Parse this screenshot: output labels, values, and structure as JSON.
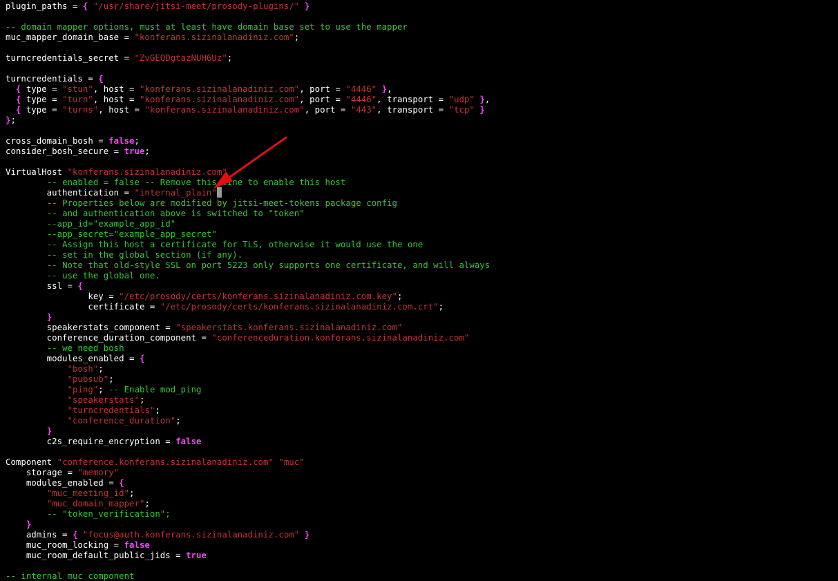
{
  "editor": {
    "colors": {
      "background": "#000000",
      "plain": "#ffffff",
      "string": "#c83232",
      "comment": "#32c832",
      "keyword": "#ff40ff",
      "cursor": "#9a9a9a",
      "annotation_arrow": "#e01010"
    },
    "lines": [
      [
        [
          "plain",
          "plugin_paths = "
        ],
        [
          "brace",
          "{"
        ],
        [
          "plain",
          " "
        ],
        [
          "str",
          "\"/usr/share/jitsi-meet/prosody-plugins/\""
        ],
        [
          "plain",
          " "
        ],
        [
          "brace",
          "}"
        ]
      ],
      [],
      [
        [
          "cmt",
          "-- domain mapper options, must at least have domain base set to use the mapper"
        ]
      ],
      [
        [
          "plain",
          "muc_mapper_domain_base = "
        ],
        [
          "str",
          "\"konferans.sizinalanadiniz.com\""
        ],
        [
          "plain",
          ";"
        ]
      ],
      [],
      [
        [
          "plain",
          "turncredentials_secret = "
        ],
        [
          "str",
          "\"ZvGEQDgtazNUH6Uz\""
        ],
        [
          "plain",
          ";"
        ]
      ],
      [],
      [
        [
          "plain",
          "turncredentials = "
        ],
        [
          "brace",
          "{"
        ]
      ],
      [
        [
          "plain",
          "  "
        ],
        [
          "brace",
          "{"
        ],
        [
          "plain",
          " type = "
        ],
        [
          "str",
          "\"stun\""
        ],
        [
          "plain",
          ", host = "
        ],
        [
          "str",
          "\"konferans.sizinalanadiniz.com\""
        ],
        [
          "plain",
          ", port = "
        ],
        [
          "str",
          "\"4446\""
        ],
        [
          "plain",
          " "
        ],
        [
          "brace",
          "}"
        ],
        [
          "plain",
          ","
        ]
      ],
      [
        [
          "plain",
          "  "
        ],
        [
          "brace",
          "{"
        ],
        [
          "plain",
          " type = "
        ],
        [
          "str",
          "\"turn\""
        ],
        [
          "plain",
          ", host = "
        ],
        [
          "str",
          "\"konferans.sizinalanadiniz.com\""
        ],
        [
          "plain",
          ", port = "
        ],
        [
          "str",
          "\"4446\""
        ],
        [
          "plain",
          ", transport = "
        ],
        [
          "str",
          "\"udp\""
        ],
        [
          "plain",
          " "
        ],
        [
          "brace",
          "}"
        ],
        [
          "plain",
          ","
        ]
      ],
      [
        [
          "plain",
          "  "
        ],
        [
          "brace",
          "{"
        ],
        [
          "plain",
          " type = "
        ],
        [
          "str",
          "\"turns\""
        ],
        [
          "plain",
          ", host = "
        ],
        [
          "str",
          "\"konferans.sizinalanadiniz.com\""
        ],
        [
          "plain",
          ", port = "
        ],
        [
          "str",
          "\"443\""
        ],
        [
          "plain",
          ", transport = "
        ],
        [
          "str",
          "\"tcp\""
        ],
        [
          "plain",
          " "
        ],
        [
          "brace",
          "}"
        ]
      ],
      [
        [
          "brace",
          "}"
        ],
        [
          "plain",
          ";"
        ]
      ],
      [],
      [
        [
          "plain",
          "cross_domain_bosh = "
        ],
        [
          "kw",
          "false"
        ],
        [
          "plain",
          ";"
        ]
      ],
      [
        [
          "plain",
          "consider_bosh_secure = "
        ],
        [
          "kw",
          "true"
        ],
        [
          "plain",
          ";"
        ]
      ],
      [],
      [
        [
          "plain",
          "VirtualHost "
        ],
        [
          "str",
          "\"konferans.sizinalanadiniz.com\""
        ]
      ],
      [
        [
          "plain",
          "        "
        ],
        [
          "cmt",
          "-- enabled = false -- Remove this line to enable this host"
        ]
      ],
      [
        [
          "plain",
          "        authentication = "
        ],
        [
          "str",
          "\"internal_plain\""
        ],
        [
          "cursor",
          " "
        ]
      ],
      [
        [
          "plain",
          "        "
        ],
        [
          "cmt",
          "-- Properties below are modified by jitsi-meet-tokens package config"
        ]
      ],
      [
        [
          "plain",
          "        "
        ],
        [
          "cmt",
          "-- and authentication above is switched to \"token\""
        ]
      ],
      [
        [
          "plain",
          "        "
        ],
        [
          "cmt",
          "--app_id=\"example_app_id\""
        ]
      ],
      [
        [
          "plain",
          "        "
        ],
        [
          "cmt",
          "--app_secret=\"example_app_secret\""
        ]
      ],
      [
        [
          "plain",
          "        "
        ],
        [
          "cmt",
          "-- Assign this host a certificate for TLS, otherwise it would use the one"
        ]
      ],
      [
        [
          "plain",
          "        "
        ],
        [
          "cmt",
          "-- set in the global section (if any)."
        ]
      ],
      [
        [
          "plain",
          "        "
        ],
        [
          "cmt",
          "-- Note that old-style SSL on port 5223 only supports one certificate, and will always"
        ]
      ],
      [
        [
          "plain",
          "        "
        ],
        [
          "cmt",
          "-- use the global one."
        ]
      ],
      [
        [
          "plain",
          "        ssl = "
        ],
        [
          "brace",
          "{"
        ]
      ],
      [
        [
          "plain",
          "                key = "
        ],
        [
          "str",
          "\"/etc/prosody/certs/konferans.sizinalanadiniz.com.key\""
        ],
        [
          "plain",
          ";"
        ]
      ],
      [
        [
          "plain",
          "                certificate = "
        ],
        [
          "str",
          "\"/etc/prosody/certs/konferans.sizinalanadiniz.com.crt\""
        ],
        [
          "plain",
          ";"
        ]
      ],
      [
        [
          "plain",
          "        "
        ],
        [
          "brace",
          "}"
        ]
      ],
      [
        [
          "plain",
          "        speakerstats_component = "
        ],
        [
          "str",
          "\"speakerstats.konferans.sizinalanadiniz.com\""
        ]
      ],
      [
        [
          "plain",
          "        conference_duration_component = "
        ],
        [
          "str",
          "\"conferenceduration.konferans.sizinalanadiniz.com\""
        ]
      ],
      [
        [
          "plain",
          "        "
        ],
        [
          "cmt",
          "-- we need bosh"
        ]
      ],
      [
        [
          "plain",
          "        modules_enabled = "
        ],
        [
          "brace",
          "{"
        ]
      ],
      [
        [
          "plain",
          "            "
        ],
        [
          "str",
          "\"bosh\""
        ],
        [
          "plain",
          ";"
        ]
      ],
      [
        [
          "plain",
          "            "
        ],
        [
          "str",
          "\"pubsub\""
        ],
        [
          "plain",
          ";"
        ]
      ],
      [
        [
          "plain",
          "            "
        ],
        [
          "str",
          "\"ping\""
        ],
        [
          "plain",
          "; "
        ],
        [
          "cmt",
          "-- Enable mod_ping"
        ]
      ],
      [
        [
          "plain",
          "            "
        ],
        [
          "str",
          "\"speakerstats\""
        ],
        [
          "plain",
          ";"
        ]
      ],
      [
        [
          "plain",
          "            "
        ],
        [
          "str",
          "\"turncredentials\""
        ],
        [
          "plain",
          ";"
        ]
      ],
      [
        [
          "plain",
          "            "
        ],
        [
          "str",
          "\"conference_duration\""
        ],
        [
          "plain",
          ";"
        ]
      ],
      [
        [
          "plain",
          "        "
        ],
        [
          "brace",
          "}"
        ]
      ],
      [
        [
          "plain",
          "        c2s_require_encryption = "
        ],
        [
          "kw",
          "false"
        ]
      ],
      [],
      [
        [
          "plain",
          "Component "
        ],
        [
          "str",
          "\"conference.konferans.sizinalanadiniz.com\""
        ],
        [
          "plain",
          " "
        ],
        [
          "str",
          "\"muc\""
        ]
      ],
      [
        [
          "plain",
          "    storage = "
        ],
        [
          "str",
          "\"memory\""
        ]
      ],
      [
        [
          "plain",
          "    modules_enabled = "
        ],
        [
          "brace",
          "{"
        ]
      ],
      [
        [
          "plain",
          "        "
        ],
        [
          "str",
          "\"muc_meeting_id\""
        ],
        [
          "plain",
          ";"
        ]
      ],
      [
        [
          "plain",
          "        "
        ],
        [
          "str",
          "\"muc_domain_mapper\""
        ],
        [
          "plain",
          ";"
        ]
      ],
      [
        [
          "plain",
          "        "
        ],
        [
          "cmt",
          "-- \"token_verification\";"
        ]
      ],
      [
        [
          "plain",
          "    "
        ],
        [
          "brace",
          "}"
        ]
      ],
      [
        [
          "plain",
          "    admins = "
        ],
        [
          "brace",
          "{"
        ],
        [
          "plain",
          " "
        ],
        [
          "str",
          "\"focus@auth.konferans.sizinalanadiniz.com\""
        ],
        [
          "plain",
          " "
        ],
        [
          "brace",
          "}"
        ]
      ],
      [
        [
          "plain",
          "    muc_room_locking = "
        ],
        [
          "kw",
          "false"
        ]
      ],
      [
        [
          "plain",
          "    muc_room_default_public_jids = "
        ],
        [
          "kw",
          "true"
        ]
      ],
      [],
      [
        [
          "cmt",
          "-- internal muc component"
        ]
      ]
    ]
  }
}
